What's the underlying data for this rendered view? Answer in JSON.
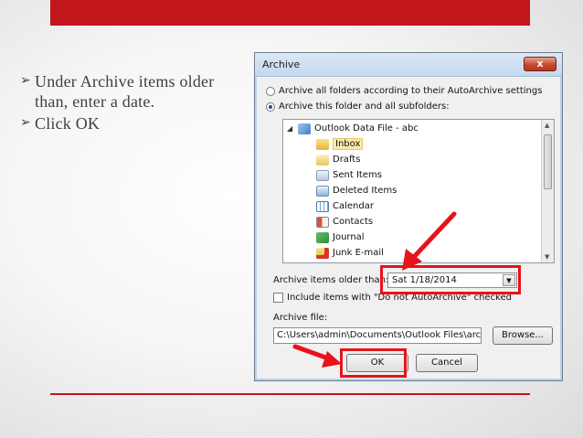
{
  "bullets": [
    "Under Archive items older than, enter a date.",
    "Click OK"
  ],
  "colors": {
    "accent": "#c0161c",
    "arrow": "#e8121a"
  },
  "dialog": {
    "title": "Archive",
    "close_label": "x",
    "radio_all": "Archive all folders according to their AutoArchive settings",
    "radio_this": "Archive this folder and all subfolders:",
    "tree": [
      {
        "label": "Outlook Data File - abc",
        "icon": "data-file-icon",
        "level": 0
      },
      {
        "label": "Inbox",
        "icon": "inbox-icon",
        "level": 1,
        "selected": true
      },
      {
        "label": "Drafts",
        "icon": "drafts-icon",
        "level": 1
      },
      {
        "label": "Sent Items",
        "icon": "sent-items-icon",
        "level": 1
      },
      {
        "label": "Deleted Items",
        "icon": "deleted-items-icon",
        "level": 1
      },
      {
        "label": "Calendar",
        "icon": "calendar-icon",
        "level": 1
      },
      {
        "label": "Contacts",
        "icon": "contacts-icon",
        "level": 1
      },
      {
        "label": "Journal",
        "icon": "journal-icon",
        "level": 1
      },
      {
        "label": "Junk E-mail",
        "icon": "junk-email-icon",
        "level": 1
      }
    ],
    "older_than_label": "Archive items older than:",
    "older_than_value": "Sat 1/18/2014",
    "include_label": "Include items with \"Do not AutoArchive\" checked",
    "archive_file_label": "Archive file:",
    "archive_file_value": "C:\\Users\\admin\\Documents\\Outlook Files\\archive",
    "browse_label": "Browse...",
    "ok_label": "OK",
    "cancel_label": "Cancel"
  }
}
